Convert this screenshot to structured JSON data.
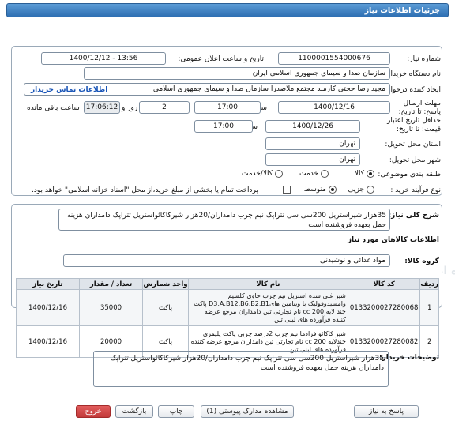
{
  "header": {
    "title": "جزئیات اطلاعات نیاز"
  },
  "fields": {
    "need_number": {
      "label": "شماره نیاز:",
      "value": "1100001554000676"
    },
    "announce_datetime": {
      "label": "تاریخ و ساعت اعلان عمومی:",
      "value": "1400/12/12 - 13:56"
    },
    "buyer_org": {
      "label": "نام دستگاه خریدار:",
      "value": "سازمان صدا و سیمای جمهوری اسلامی ایران"
    },
    "requester": {
      "label": "ایجاد کننده درخواست:",
      "value": "مجید رضا حجتی کارمند مجتمع ملاصدرا سازمان صدا و سیمای جمهوری اسلامی",
      "link": "اطلاعات تماس خریدار"
    },
    "reply_deadline": {
      "label": "مهلت ارسال پاسخ: تا تاریخ:",
      "date": "1400/12/16",
      "time_label": "ساعت",
      "time": "17:00",
      "days": "2",
      "days_label": "روز و",
      "remaining": "17:06:12",
      "remaining_label": "ساعت باقی مانده"
    },
    "price_validity": {
      "label": "حداقل تاریخ اعتبار قیمت: تا تاریخ:",
      "date": "1400/12/26",
      "time_label": "ساعت",
      "time": "17:00"
    },
    "delivery_province": {
      "label": "استان محل تحویل:",
      "value": "تهران"
    },
    "delivery_city": {
      "label": "شهر محل تحویل:",
      "value": "تهران"
    },
    "category": {
      "label": "طبقه بندی موضوعی:",
      "options": [
        "کالا",
        "خدمت",
        "کالا/خدمت"
      ],
      "selected": "کالا"
    },
    "purchase_process": {
      "label": "نوع فرآیند خرید :",
      "options": [
        "جزیی",
        "متوسط"
      ],
      "selected": "متوسط",
      "note": "پرداخت تمام یا بخشی از مبلغ خرید،از محل \"اسناد خزانه اسلامی\" خواهد بود."
    }
  },
  "summary": {
    "label": "شرح کلی نیاز:",
    "value": "35هزار شیراستریل 200سی سی تتراپک نیم چرب دامداران/20هزار شیرکاکائواستریل تتراپک دامداران هزینه حمل بعهده فروشنده است"
  },
  "goods": {
    "title": "اطلاعات کالاهای مورد نیاز",
    "group_label": "گروه کالا:",
    "group_value": "مواد غذائی و نوشیدنی",
    "columns": [
      "ردیف",
      "کد کالا",
      "نام کالا",
      "واحد شمارش",
      "تعداد / مقدار",
      "تاریخ نیاز"
    ],
    "rows": [
      {
        "row": "1",
        "code": "0133200027280068",
        "name": "شیر غنی شده استریل نیم چرب حاوی کلسیم وامسیدوفولیک با ویتامین هایD3,A,B12,B6,B2,B1 پاکت چند لایه 200 cc نام تجارتی تین دامداران مرجع عرضه کننده فرآورده های لبنی تین",
        "unit": "پاکت",
        "qty": "35000",
        "date": "1400/12/16"
      },
      {
        "row": "2",
        "code": "0133200027280082",
        "name": "شیر کاکائو فرادما نیم چرب 2درصد چربی پاکت پلیمری چندلایه 200 cc نام تجارتی تین دامداران مرجع عرضه کننده فرآورده های لبنی تین",
        "unit": "پاکت",
        "qty": "20000",
        "date": "1400/12/16"
      }
    ]
  },
  "buyer_notes": {
    "label": "توضیحات خریدار:",
    "value": "35هزار شیراستریل 200سی سی تتراپک نیم چرب دامداران/20هزار شیرکاکائواستریل تتراپک دامداران هزینه حمل بعهده فروشنده است"
  },
  "buttons": {
    "reply": "پاسخ به نیاز",
    "attachments": "مشاهده مدارک پیوستی (1)",
    "print": "چاپ",
    "back": "بازگشت",
    "exit": "خروج"
  },
  "watermark": {
    "brand": "ParsNamadData",
    "tagline": "پایگاه اطلاع رسانی مناقصات و مزایدات پارس نماد داده"
  }
}
